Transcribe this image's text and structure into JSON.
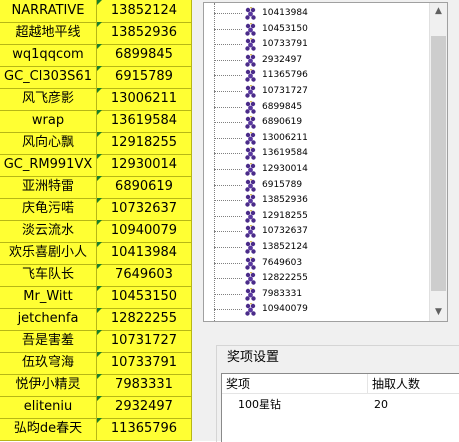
{
  "sheet": {
    "rows": [
      {
        "name": "NARRATIVE",
        "id": "13852124"
      },
      {
        "name": "超越地平线",
        "id": "13852936"
      },
      {
        "name": "wq1qqcom",
        "id": "6899845"
      },
      {
        "name": "GC_Cl303S61",
        "id": "6915789"
      },
      {
        "name": "风飞彦影",
        "id": "13006211"
      },
      {
        "name": "wrap",
        "id": "13619584"
      },
      {
        "name": "风向心飘",
        "id": "12918255"
      },
      {
        "name": "GC_RM991VX",
        "id": "12930014"
      },
      {
        "name": "亚洲特雷",
        "id": "6890619"
      },
      {
        "name": "庆龟污喏",
        "id": "10732637"
      },
      {
        "name": "淡云流水",
        "id": "10940079"
      },
      {
        "name": "欢乐喜剧小人",
        "id": "10413984"
      },
      {
        "name": "飞车队长",
        "id": "7649603"
      },
      {
        "name": "Mr_Witt",
        "id": "10453150"
      },
      {
        "name": "jetchenfa",
        "id": "12822255"
      },
      {
        "name": "吾是害羞",
        "id": "10731727"
      },
      {
        "name": "伍玖穹海",
        "id": "10733791"
      },
      {
        "name": "悦伊小精灵",
        "id": "7983331"
      },
      {
        "name": "eliteniu",
        "id": "2932497"
      },
      {
        "name": "弘昀de春天",
        "id": "11365796"
      }
    ]
  },
  "tree": {
    "icon": "grape-icon",
    "items": [
      "10413984",
      "10453150",
      "10733791",
      "2932497",
      "11365796",
      "10731727",
      "6899845",
      "6890619",
      "13006211",
      "13619584",
      "12930014",
      "6915789",
      "13852936",
      "12918255",
      "10732637",
      "13852124",
      "7649603",
      "12822255",
      "7983331",
      "10940079"
    ]
  },
  "scrollbar": {
    "up": "▲",
    "down": "▼"
  },
  "prize": {
    "group_title": "奖项设置",
    "col_prize": "奖项",
    "col_count": "抽取人数",
    "rows": [
      {
        "prize": "100星钻",
        "count": "20"
      }
    ]
  },
  "colors": {
    "sheet_bg": "#ffff33",
    "grid_line": "#b7b716",
    "marker": "#1a7f2c",
    "icon": "#4b2c8a"
  }
}
